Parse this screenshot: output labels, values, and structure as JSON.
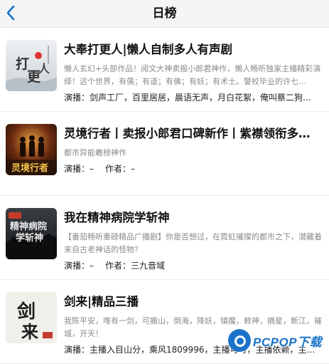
{
  "header": {
    "title": "日榜",
    "back_icon": "chevron-left-icon"
  },
  "accent_color": "#1a73c9",
  "items": [
    {
      "cover_text": "打更人",
      "title": "大奉打更人|懒人自制多人有声剧",
      "desc": "懒人玄幻+头部作品！阅文大神卖报小郎君神作，懒人畅听独家主播精彩演绎！这个世界，有儒；有道；有佛；有妖；有术士。警校毕业的许七…",
      "anchor_label": "演播：",
      "anchors": "剑声工厂，百里居居，晨语无声，月白花絮，俺叫蔡二狗…",
      "author_label": "",
      "author": ""
    },
    {
      "cover_text": "灵境行者",
      "title": "灵境行者丨卖报小郎君口碑新作丨紫襟领衔多…",
      "desc": "都市异能羲榜神作",
      "anchor_label": "演播：",
      "anchors": "–",
      "author_label": "作者：",
      "author": "–"
    },
    {
      "cover_text": "精神病院学斩神",
      "title": "我在精神病院学斩神",
      "desc": "【番茄畅听重磅精品广播剧】你是否想过，在霓虹璀璨的都市之下，潜藏着来自古老神话的怪物？",
      "anchor_label": "演播：",
      "anchors": "–",
      "author_label": "作者：",
      "author": "三九音域"
    },
    {
      "cover_text": "剑来",
      "title": "剑来|精品三播",
      "desc": "我陈平安，唯有一剑，可搬山，倒海，降妖，镇魔，敕神，摘星，断江，摧城，开天！",
      "anchor_label": "演播：",
      "anchors": "主播入目山分，乘风1809996，主播可可，主播依赖，主…",
      "author_label": "",
      "author": ""
    }
  ],
  "watermark": {
    "icon": "pcpop-logo-icon",
    "text": "PCPOP下载"
  }
}
